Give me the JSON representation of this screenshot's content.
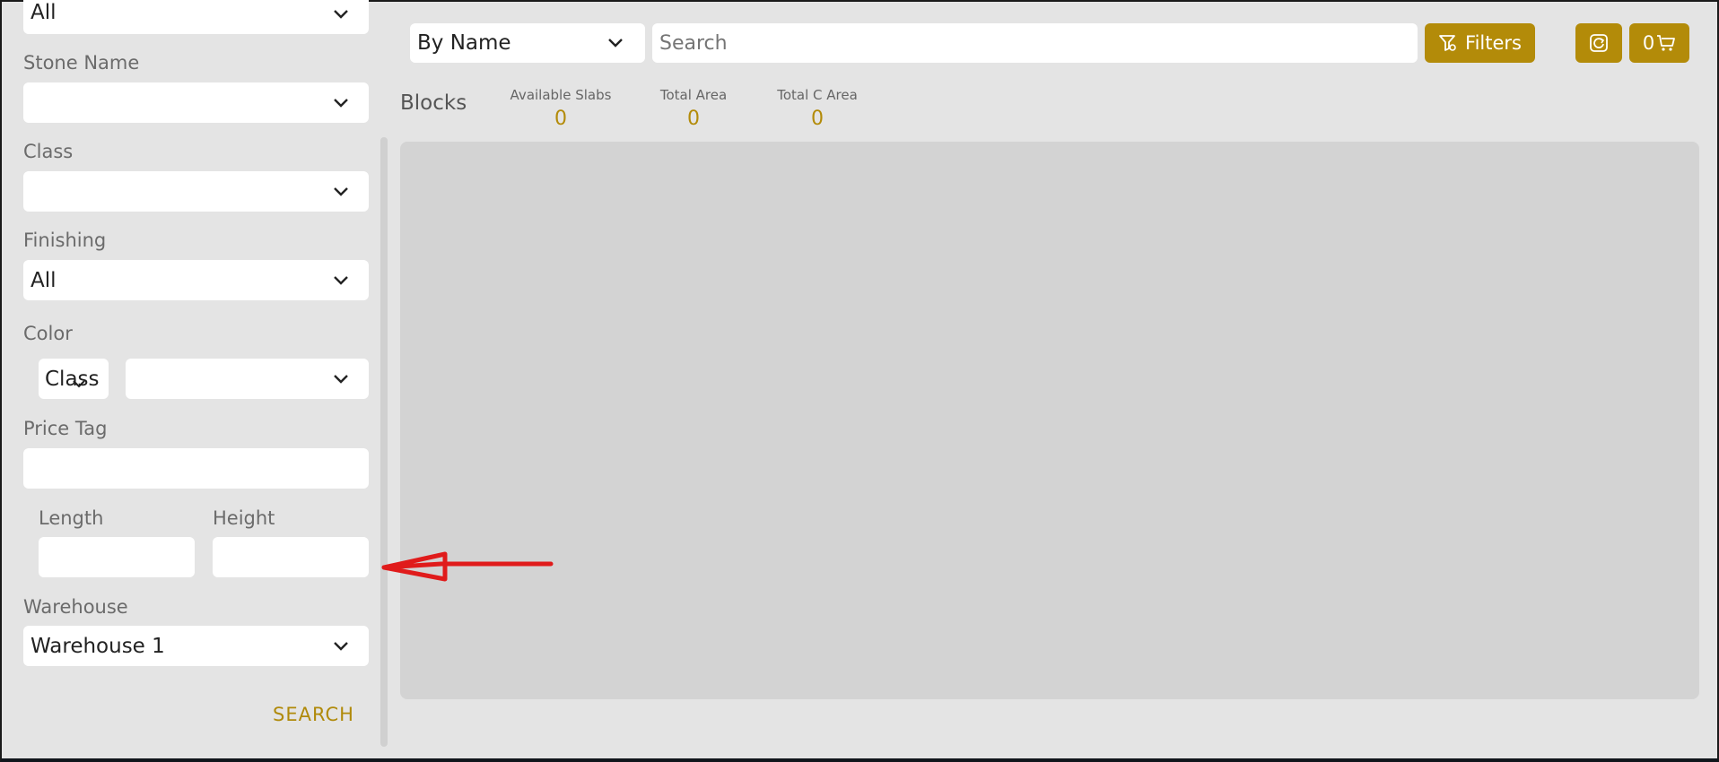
{
  "sidebar": {
    "top_select_value": "All",
    "stone_name_label": "Stone Name",
    "stone_name_value": "",
    "class_label": "Class",
    "class_value": "",
    "finishing_label": "Finishing",
    "finishing_value": "All",
    "color_label": "Color",
    "color_class_value": "Class",
    "color_value": "",
    "price_tag_label": "Price Tag",
    "price_tag_value": "",
    "length_label": "Length",
    "length_value": "",
    "height_label": "Height",
    "height_value": "",
    "warehouse_label": "Warehouse",
    "warehouse_value": "Warehouse 1",
    "search_label": "SEARCH"
  },
  "toolbar": {
    "sort_value": "By Name",
    "search_placeholder": "Search",
    "filters_label": "Filters",
    "cart_count": "0"
  },
  "summary": {
    "title": "Blocks",
    "stats": [
      {
        "label": "Available Slabs",
        "value": "0"
      },
      {
        "label": "Total Area",
        "value": "0"
      },
      {
        "label": "Total C Area",
        "value": "0"
      }
    ]
  },
  "colors": {
    "accent": "#b38b09",
    "background": "#e4e4e4",
    "panel": "#d3d3d3",
    "annotation_arrow": "#e01b1b"
  }
}
